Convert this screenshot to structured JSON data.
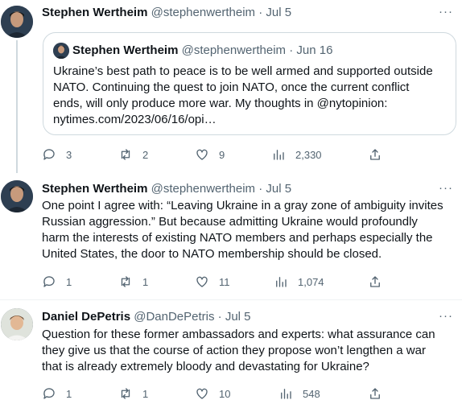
{
  "tweets": [
    {
      "name": "Stephen Wertheim",
      "handle": "@stephenwertheim",
      "sep": "·",
      "date": "Jul 5",
      "more": "···",
      "quote": {
        "name": "Stephen Wertheim",
        "handle": "@stephenwertheim",
        "sep": "·",
        "date": "Jun 16",
        "lines": [
          "Ukraine’s best path to peace is to be well armed and supported outside",
          "NATO. Continuing the quest to join NATO, once the current conflict",
          "ends, will only produce more war. My thoughts in @nytopinion:",
          "nytimes.com/2023/06/16/opi…"
        ]
      },
      "actions": {
        "replies": "3",
        "retweets": "2",
        "likes": "9",
        "views": "2,330"
      }
    },
    {
      "name": "Stephen Wertheim",
      "handle": "@stephenwertheim",
      "sep": "·",
      "date": "Jul 5",
      "more": "···",
      "lines": [
        "One point I agree with: “Leaving Ukraine in a gray zone of ambiguity invites",
        "Russian aggression.” But because admitting Ukraine would profoundly",
        "harm the interests of existing NATO members and perhaps especially the",
        "United States, the door to NATO membership should be closed."
      ],
      "actions": {
        "replies": "1",
        "retweets": "1",
        "likes": "11",
        "views": "1,074"
      }
    },
    {
      "name": "Daniel DePetris",
      "handle": "@DanDePetris",
      "sep": "·",
      "date": "Jul 5",
      "more": "···",
      "lines": [
        "Question for these former ambassadors and experts: what assurance can",
        "they give us that the course of action they propose won’t lengthen a war",
        "that is already extremely bloody and devastating for Ukraine?"
      ],
      "actions": {
        "replies": "1",
        "retweets": "1",
        "likes": "10",
        "views": "548"
      }
    }
  ]
}
